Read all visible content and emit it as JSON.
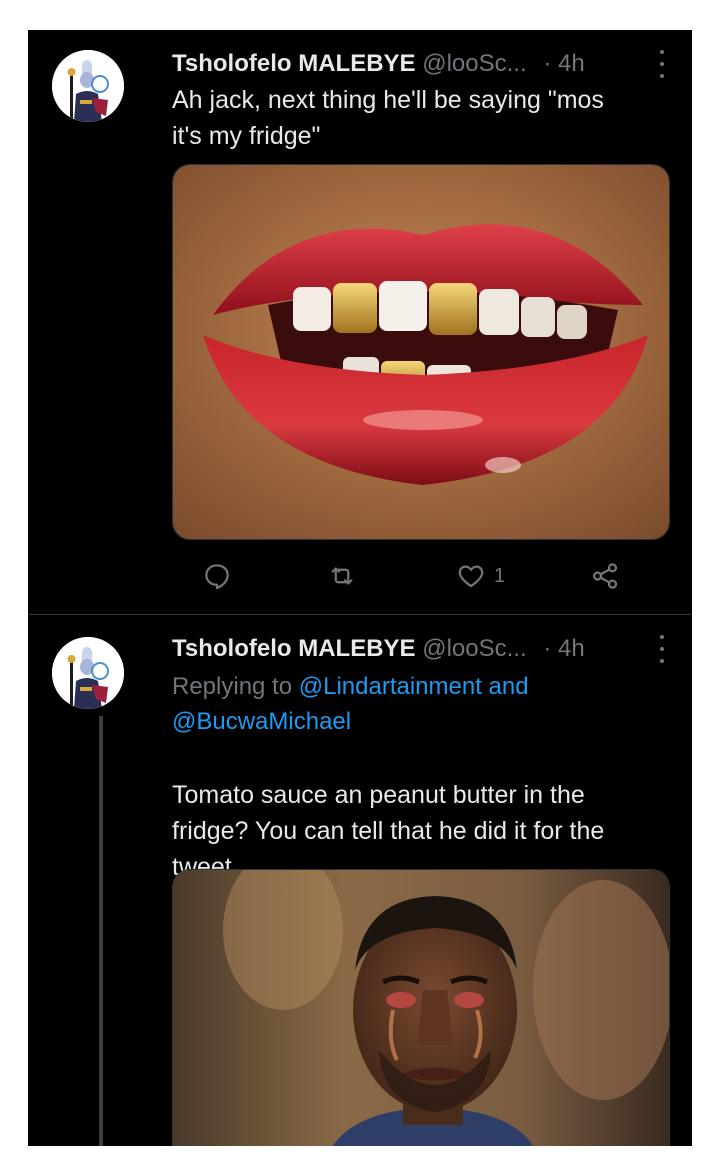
{
  "colors": {
    "background": "#000000",
    "text": "#e7e9ea",
    "secondary": "#71767b",
    "link": "#1d9bf0",
    "divider": "#2f3336"
  },
  "tweets": [
    {
      "author_name": "Tsholofelo MALEBYE",
      "handle": "@looSc...",
      "separator": "·",
      "time": "4h",
      "text_lines": [
        "Ah jack, next thing he'll be saying \"mos",
        "it's my fridge\""
      ],
      "media_icon": "lips-gold-teeth-photo",
      "actions": {
        "reply_icon": "reply-icon",
        "retweet_icon": "retweet-icon",
        "like_icon": "heart-icon",
        "like_count": "1",
        "share_icon": "share-icon"
      }
    },
    {
      "author_name": "Tsholofelo MALEBYE",
      "handle": "@looSc...",
      "separator": "·",
      "time": "4h",
      "replying_to_prefix": "Replying to ",
      "mention_1": "@Lindartainment",
      "connector": " and",
      "mention_2": "@BucwaMichael",
      "text_lines": [
        "Tomato sauce an peanut butter in the",
        "fridge? You can tell that he did it for the",
        "tweet"
      ],
      "media_icon": "crying-man-photo"
    }
  ]
}
